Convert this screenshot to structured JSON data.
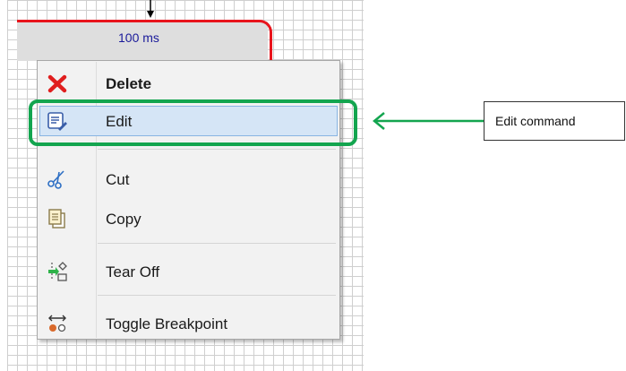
{
  "diagram_block": {
    "label": "100 ms"
  },
  "context_menu": {
    "items": [
      {
        "label": "Delete",
        "icon": "delete-x-icon"
      },
      {
        "label": "Edit",
        "icon": "edit-icon"
      },
      {
        "label": "Cut",
        "icon": "scissors-icon"
      },
      {
        "label": "Copy",
        "icon": "copy-icon"
      },
      {
        "label": "Tear Off",
        "icon": "tear-off-icon"
      },
      {
        "label": "Toggle Breakpoint",
        "icon": "breakpoint-icon"
      }
    ],
    "highlighted_item": "Edit"
  },
  "annotation": {
    "callout_text": "Edit command",
    "highlight_color": "#13a54f"
  },
  "colors": {
    "block_border": "#e8141c",
    "menu_background": "#f2f2f2",
    "menu_highlight": "#d5e5f6"
  }
}
